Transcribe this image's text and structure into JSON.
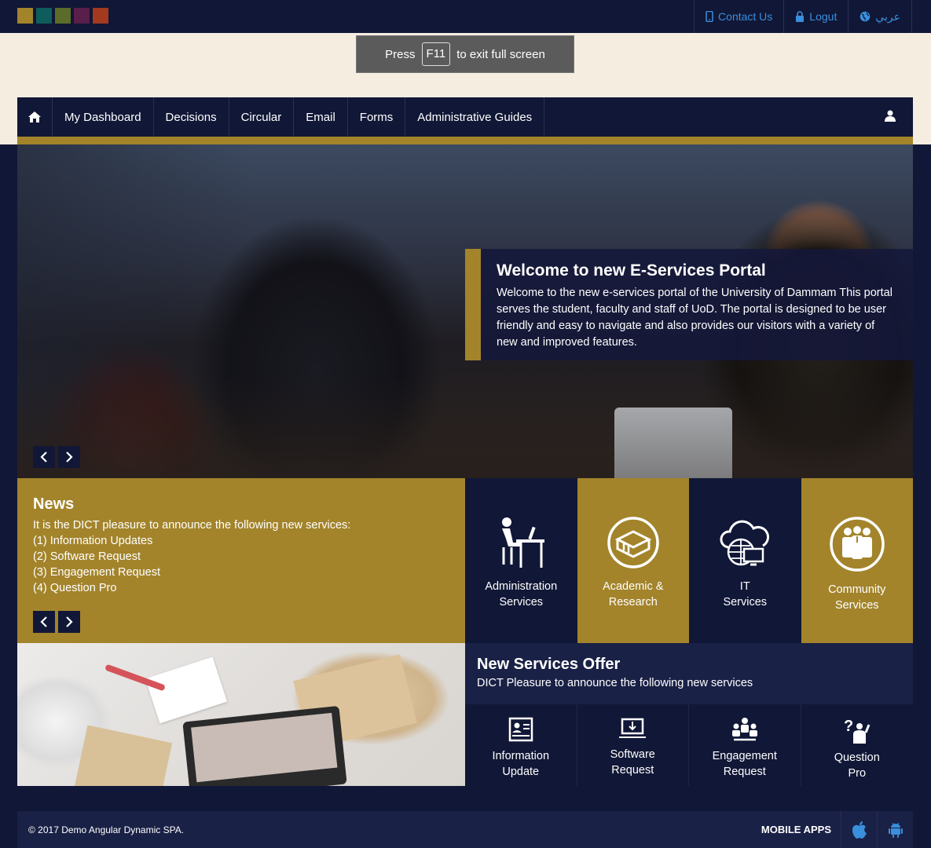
{
  "theme": {
    "navy": "#111736",
    "gold": "#a3842b",
    "cream": "#f5ede0",
    "link_blue": "#3a8fdc",
    "swatches": [
      "#a3842b",
      "#0f5c5c",
      "#5b6b2a",
      "#5a1e4a",
      "#a33a1e"
    ]
  },
  "topbar": {
    "contact": "Contact Us",
    "logout": "Logut",
    "language": "عربي"
  },
  "fullscreen": {
    "press": "Press",
    "key": "F11",
    "rest": "to exit full screen"
  },
  "nav": {
    "items": [
      "My Dashboard",
      "Decisions",
      "Circular",
      "Email",
      "Forms",
      "Administrative Guides"
    ]
  },
  "hero": {
    "title": "Welcome to new E-Services Portal",
    "text": "Welcome to the new e-services portal of the University of Dammam This portal serves the student, faculty and staff of UoD. The portal is designed to be user friendly and easy to navigate and also provides our visitors with a variety of new and improved features."
  },
  "news": {
    "title": "News",
    "intro": "It is the DICT pleasure to announce the following new services:",
    "items": [
      "(1) Information Updates",
      "(2) Software Request",
      "(3) Engagement Request",
      "(4) Question Pro"
    ]
  },
  "services": [
    {
      "line1": "Administration",
      "line2": "Services",
      "icon": "desk-user-icon"
    },
    {
      "line1": "Academic &",
      "line2": "Research",
      "icon": "books-icon"
    },
    {
      "line1": "IT",
      "line2": "Services",
      "icon": "cloud-globe-icon"
    },
    {
      "line1": "Community",
      "line2": "Services",
      "icon": "group-icon"
    }
  ],
  "offer": {
    "title": "New Services Offer",
    "subtitle": "DICT Pleasure to announce the following new services",
    "items": [
      {
        "line1": "Information",
        "line2": "Update",
        "icon": "id-card-icon"
      },
      {
        "line1": "Software",
        "line2": "Request",
        "icon": "laptop-download-icon"
      },
      {
        "line1": "Engagement",
        "line2": "Request",
        "icon": "team-icon"
      },
      {
        "line1": "Question",
        "line2": "Pro",
        "icon": "question-person-icon"
      }
    ]
  },
  "footer": {
    "copyright": "© 2017 Demo Angular Dynamic SPA.",
    "mobile_apps": "MOBILE APPS"
  }
}
